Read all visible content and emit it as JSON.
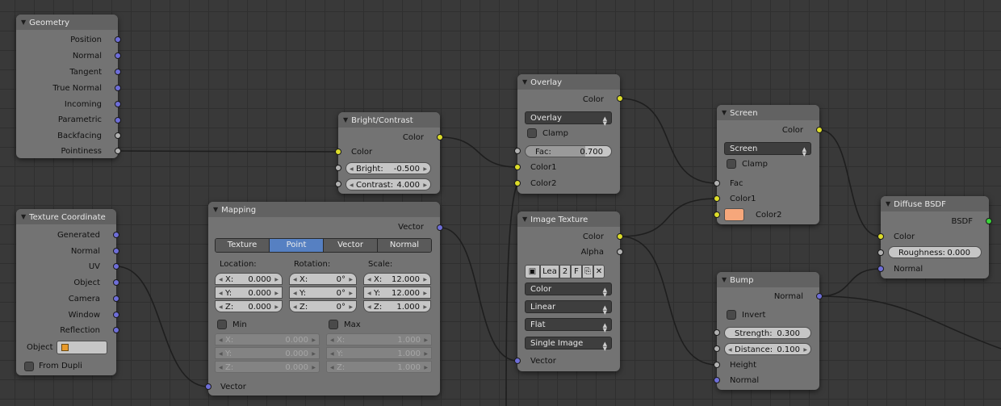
{
  "colors": {
    "background": "#393939",
    "node_body": "#737373",
    "node_header": "#626262",
    "socket_color": "#dcdc2a",
    "socket_vector": "#6e6ed8",
    "socket_value": "#b2b2b2",
    "socket_shader": "#39d339",
    "tab_active": "#5680c2",
    "color2_swatch": "#f6a77b"
  },
  "geometry": {
    "title": "Geometry",
    "outputs": [
      "Position",
      "Normal",
      "Tangent",
      "True Normal",
      "Incoming",
      "Parametric",
      "Backfacing",
      "Pointiness"
    ]
  },
  "texcoord": {
    "title": "Texture Coordinate",
    "outputs": [
      "Generated",
      "Normal",
      "UV",
      "Object",
      "Camera",
      "Window",
      "Reflection"
    ],
    "object_label": "Object",
    "object_icon": "cube-icon",
    "from_dupli": "From Dupli"
  },
  "bright": {
    "title": "Bright/Contrast",
    "output": "Color",
    "input_color": "Color",
    "bright_label": "Bright:",
    "bright_value": "-0.500",
    "contrast_label": "Contrast:",
    "contrast_value": "4.000"
  },
  "mapping": {
    "title": "Mapping",
    "output": "Vector",
    "tabs": [
      "Texture",
      "Point",
      "Vector",
      "Normal"
    ],
    "active_tab": "Point",
    "location_label": "Location:",
    "rotation_label": "Rotation:",
    "scale_label": "Scale:",
    "loc": [
      {
        "axis": "X:",
        "value": "0.000"
      },
      {
        "axis": "Y:",
        "value": "0.000"
      },
      {
        "axis": "Z:",
        "value": "0.000"
      }
    ],
    "rot": [
      {
        "axis": "X:",
        "value": "0°"
      },
      {
        "axis": "Y:",
        "value": "0°"
      },
      {
        "axis": "Z:",
        "value": "0°"
      }
    ],
    "scale": [
      {
        "axis": "X:",
        "value": "12.000"
      },
      {
        "axis": "Y:",
        "value": "12.000"
      },
      {
        "axis": "Z:",
        "value": "1.000"
      }
    ],
    "min_label": "Min",
    "max_label": "Max",
    "min": [
      {
        "axis": "X:",
        "value": "0.000"
      },
      {
        "axis": "Y:",
        "value": "0.000"
      },
      {
        "axis": "Z:",
        "value": "0.000"
      }
    ],
    "max": [
      {
        "axis": "X:",
        "value": "1.000"
      },
      {
        "axis": "Y:",
        "value": "1.000"
      },
      {
        "axis": "Z:",
        "value": "1.000"
      }
    ],
    "input": "Vector"
  },
  "overlay": {
    "title": "Overlay",
    "output": "Color",
    "blend": "Overlay",
    "clamp": "Clamp",
    "fac_label": "Fac:",
    "fac_value": "0.700",
    "fac": 0.7,
    "inputs": [
      "Color1",
      "Color2"
    ]
  },
  "image": {
    "title": "Image Texture",
    "outputs": [
      "Color",
      "Alpha"
    ],
    "image_name": "Lea",
    "users": "2",
    "fake": "F",
    "color_space": "Color",
    "interpolation": "Linear",
    "projection": "Flat",
    "extension": "Single Image",
    "input": "Vector"
  },
  "screen": {
    "title": "Screen",
    "output": "Color",
    "blend": "Screen",
    "clamp": "Clamp",
    "inputs": [
      "Fac",
      "Color1",
      "Color2"
    ]
  },
  "bump": {
    "title": "Bump",
    "output": "Normal",
    "invert": "Invert",
    "strength_label": "Strength:",
    "strength_value": "0.300",
    "distance_label": "Distance:",
    "distance_value": "0.100",
    "inputs": [
      "Height",
      "Normal"
    ]
  },
  "diffuse": {
    "title": "Diffuse BSDF",
    "output": "BSDF",
    "input_color": "Color",
    "roughness_label": "Roughness:",
    "roughness_value": "0.000",
    "input_normal": "Normal"
  }
}
